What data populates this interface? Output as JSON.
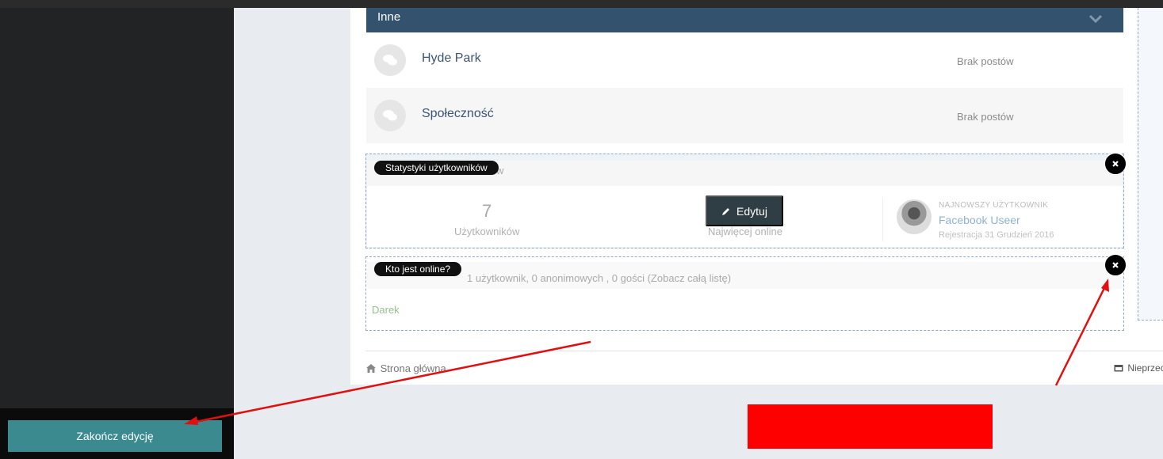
{
  "category": {
    "title": "Inne"
  },
  "forums": [
    {
      "title": "Hyde Park",
      "status": "Brak postów"
    },
    {
      "title": "Społeczność",
      "status": "Brak postów"
    }
  ],
  "stats_widget": {
    "badge": "Statystyki użytkowników",
    "header_visible": "w",
    "users_count": "7",
    "users_label": "Użytkowników",
    "most_online_label": "Najwięcej online",
    "newest_caption": "NAJNOWSZY UŻYTKOWNIK",
    "newest_name": "Facebook Useer",
    "newest_registered": "Rejestracja 31 Grudzień 2016"
  },
  "edit_button": {
    "label": "Edytuj"
  },
  "online_widget": {
    "badge": "Kto jest online?",
    "summary": "1 użytkownik, 0 anonimowych , 0 gości (Zobacz całą listę)",
    "users": "Darek"
  },
  "footer": {
    "home": "Strona główna",
    "right": "Nieprzec"
  },
  "finish_button": {
    "label": "Zakończ edycję"
  },
  "colors": {
    "header": "#33526e",
    "finish": "#3b8a8f",
    "red_box": "#ff0000",
    "arrow": "#e01010"
  }
}
